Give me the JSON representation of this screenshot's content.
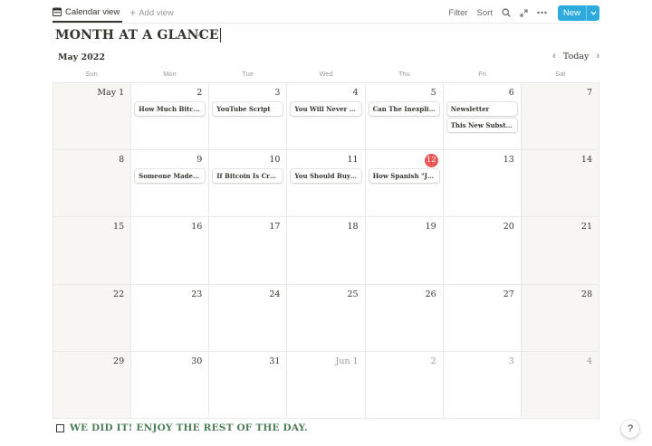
{
  "toolbar": {
    "view_tab_label": "Calendar view",
    "add_view_label": "Add view",
    "filter_label": "Filter",
    "sort_label": "Sort",
    "new_label": "New",
    "accent_color": "#2eaadc"
  },
  "page": {
    "title": "MONTH AT A GLANCE",
    "more_label": "···"
  },
  "calendar": {
    "month_label": "May 2022",
    "today_label": "Today",
    "weekdays": [
      "Sun",
      "Mon",
      "Tue",
      "Wed",
      "Thu",
      "Fri",
      "Sat"
    ],
    "today_color": "#eb5757",
    "weeks": [
      [
        {
          "label": "May 1",
          "weekend": true,
          "other": false,
          "events": []
        },
        {
          "label": "2",
          "weekend": false,
          "other": false,
          "events": [
            "How Much Bitcoin ..."
          ]
        },
        {
          "label": "3",
          "weekend": false,
          "other": false,
          "events": [
            "YouTube Script"
          ]
        },
        {
          "label": "4",
          "weekend": false,
          "other": false,
          "events": [
            "You Will Never Be ..."
          ]
        },
        {
          "label": "5",
          "weekend": false,
          "other": false,
          "events": [
            "Can The Inexplicab..."
          ]
        },
        {
          "label": "6",
          "weekend": false,
          "other": false,
          "events": [
            "Newsletter",
            "This New Substack ..."
          ]
        },
        {
          "label": "7",
          "weekend": true,
          "other": false,
          "events": []
        }
      ],
      [
        {
          "label": "8",
          "weekend": true,
          "other": false,
          "events": []
        },
        {
          "label": "9",
          "weekend": false,
          "other": false,
          "events": [
            "Someone Made The..."
          ]
        },
        {
          "label": "10",
          "weekend": false,
          "other": false,
          "events": [
            "If Bitcoin Is Crashin..."
          ]
        },
        {
          "label": "11",
          "weekend": false,
          "other": false,
          "events": [
            "You Should Buy Th..."
          ]
        },
        {
          "label": "12",
          "weekend": false,
          "other": false,
          "today": true,
          "events": [
            "How Spanish \"Jorn..."
          ]
        },
        {
          "label": "13",
          "weekend": false,
          "other": false,
          "events": []
        },
        {
          "label": "14",
          "weekend": true,
          "other": false,
          "events": []
        }
      ],
      [
        {
          "label": "15",
          "weekend": true,
          "other": false,
          "events": []
        },
        {
          "label": "16",
          "weekend": false,
          "other": false,
          "events": []
        },
        {
          "label": "17",
          "weekend": false,
          "other": false,
          "events": []
        },
        {
          "label": "18",
          "weekend": false,
          "other": false,
          "events": []
        },
        {
          "label": "19",
          "weekend": false,
          "other": false,
          "events": []
        },
        {
          "label": "20",
          "weekend": false,
          "other": false,
          "events": []
        },
        {
          "label": "21",
          "weekend": true,
          "other": false,
          "events": []
        }
      ],
      [
        {
          "label": "22",
          "weekend": true,
          "other": false,
          "events": []
        },
        {
          "label": "23",
          "weekend": false,
          "other": false,
          "events": []
        },
        {
          "label": "24",
          "weekend": false,
          "other": false,
          "events": []
        },
        {
          "label": "25",
          "weekend": false,
          "other": false,
          "events": []
        },
        {
          "label": "26",
          "weekend": false,
          "other": false,
          "events": []
        },
        {
          "label": "27",
          "weekend": false,
          "other": false,
          "events": []
        },
        {
          "label": "28",
          "weekend": true,
          "other": false,
          "events": []
        }
      ],
      [
        {
          "label": "29",
          "weekend": true,
          "other": false,
          "events": []
        },
        {
          "label": "30",
          "weekend": false,
          "other": false,
          "events": []
        },
        {
          "label": "31",
          "weekend": false,
          "other": false,
          "events": []
        },
        {
          "label": "Jun 1",
          "weekend": false,
          "other": true,
          "events": []
        },
        {
          "label": "2",
          "weekend": false,
          "other": true,
          "events": []
        },
        {
          "label": "3",
          "weekend": false,
          "other": true,
          "events": []
        },
        {
          "label": "4",
          "weekend": true,
          "other": true,
          "events": []
        }
      ]
    ]
  },
  "footer": {
    "todo_text": "WE DID IT! ENJOY THE REST OF THE DAY.",
    "todo_checked": false,
    "todo_color": "#4d7c59",
    "help_label": "?"
  }
}
